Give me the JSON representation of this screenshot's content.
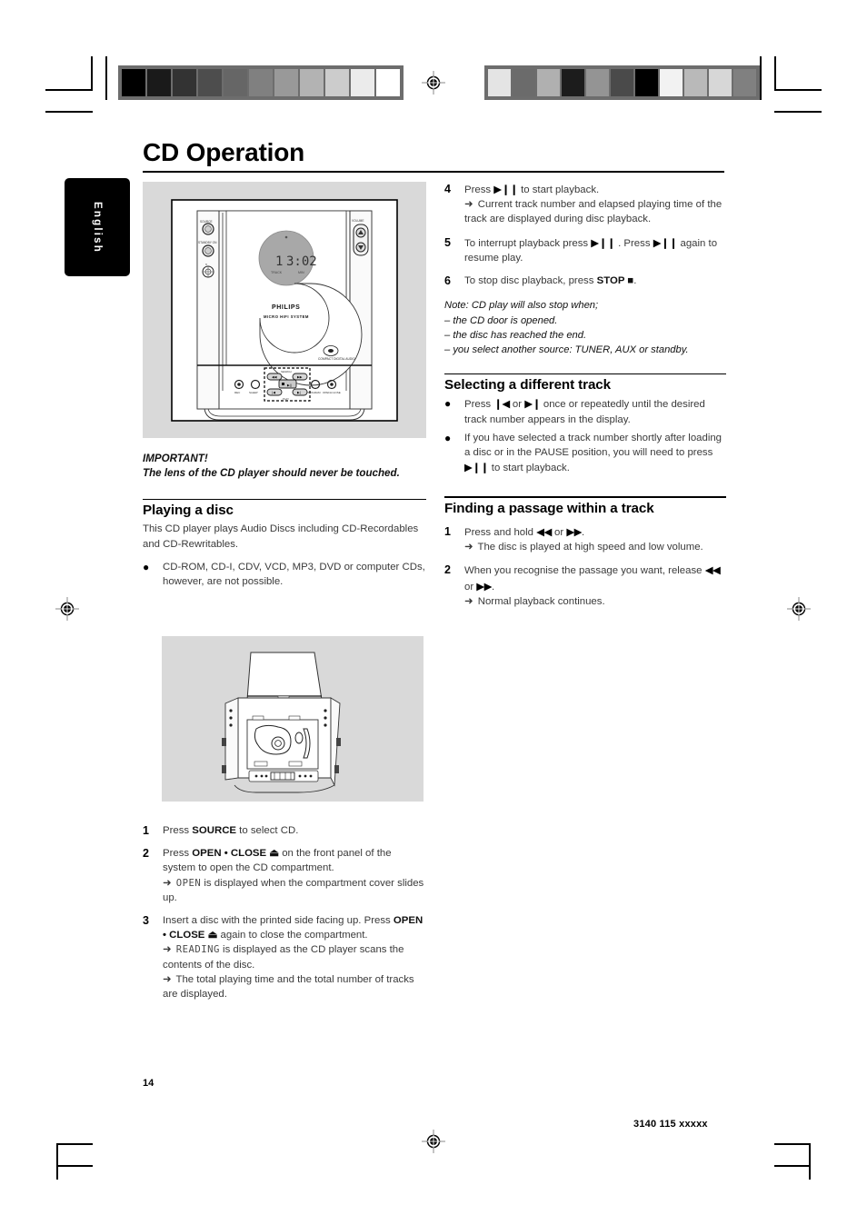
{
  "page": {
    "title": "CD Operation",
    "language_tab": "English",
    "page_number": "14",
    "document_number": "3140 115 xxxxx"
  },
  "device_illustration": {
    "display_track": "1",
    "display_time": "3:02",
    "display_label_track": "TRACK",
    "display_label_min": "MIN",
    "brand": "PHILIPS",
    "brand_sub": "MICRO HIFI SYSTEM",
    "cd_logo": "COMPACT",
    "cd_logo_sub": "DIGITAL AUDIO",
    "left_controls": [
      "SOURCE",
      "STANDBY ON",
      "PHONES"
    ],
    "right_control": "VOLUME",
    "front_buttons": [
      "REC",
      "SLEEP",
      "PROGRAM",
      "OPEN•CLOSE"
    ],
    "transport_labels": [
      "SEARCH",
      "PLAY"
    ]
  },
  "left_column": {
    "important_title": "IMPORTANT!",
    "important_body": "The lens of the CD player should never be touched.",
    "playing_heading": "Playing a disc",
    "playing_intro": "This CD player plays Audio Discs including CD-Recordables and CD-Rewritables.",
    "playing_bullet": "CD-ROM, CD-I, CDV, VCD, MP3, DVD or computer CDs, however, are not possible.",
    "steps": [
      {
        "num": "1",
        "parts": [
          {
            "t": "Press ",
            "s": "n"
          },
          {
            "t": "SOURCE",
            "s": "b"
          },
          {
            "t": " to select CD.",
            "s": "n"
          }
        ]
      },
      {
        "num": "2",
        "parts": [
          {
            "t": "Press ",
            "s": "n"
          },
          {
            "t": "OPEN • CLOSE",
            "s": "b"
          },
          {
            "t": " ⏏",
            "s": "b"
          },
          {
            "t": " on the front panel of the system to open the CD compartment.",
            "s": "n"
          }
        ],
        "results": [
          {
            "pre": "",
            "lcd": "OPEN",
            "post": " is displayed when the compartment cover slides up."
          }
        ]
      },
      {
        "num": "3",
        "parts": [
          {
            "t": "Insert a disc with the printed side facing up. Press ",
            "s": "n"
          },
          {
            "t": "OPEN • CLOSE",
            "s": "b"
          },
          {
            "t": " ⏏",
            "s": "b"
          },
          {
            "t": " again to close the compartment.",
            "s": "n"
          }
        ],
        "results": [
          {
            "pre": "",
            "lcd": "READING",
            "post": " is displayed as the CD player scans the contents of the disc."
          },
          {
            "pre": "The total playing time and the total number of tracks are displayed.",
            "lcd": "",
            "post": ""
          }
        ]
      }
    ]
  },
  "right_column": {
    "steps": [
      {
        "num": "4",
        "parts": [
          {
            "t": "Press ",
            "s": "n"
          },
          {
            "t": "▶❙❙",
            "s": "g"
          },
          {
            "t": " to start playback.",
            "s": "n"
          }
        ],
        "results": [
          {
            "pre": "Current track number and elapsed playing time of the track are displayed during disc playback.",
            "lcd": "",
            "post": ""
          }
        ]
      },
      {
        "num": "5",
        "parts": [
          {
            "t": "To interrupt playback press ",
            "s": "n"
          },
          {
            "t": "▶❙❙",
            "s": "g"
          },
          {
            "t": " . Press ",
            "s": "n"
          },
          {
            "t": "▶❙❙",
            "s": "g"
          },
          {
            "t": " again to resume play.",
            "s": "n"
          }
        ]
      },
      {
        "num": "6",
        "parts": [
          {
            "t": "To stop disc playback, press ",
            "s": "n"
          },
          {
            "t": "STOP",
            "s": "b"
          },
          {
            "t": " ■",
            "s": "b"
          },
          {
            "t": ".",
            "s": "n"
          }
        ]
      }
    ],
    "note_lines": [
      "Note: CD play will also stop when;",
      "– the CD door is opened.",
      "– the disc has reached the end.",
      "– you select another source: TUNER, AUX or standby."
    ],
    "selecting_heading": "Selecting a different track",
    "selecting_bullets": [
      [
        {
          "t": "Press ",
          "s": "n"
        },
        {
          "t": "❙◀",
          "s": "g"
        },
        {
          "t": "  or ",
          "s": "n"
        },
        {
          "t": "▶❙",
          "s": "g"
        },
        {
          "t": "  once or repeatedly until the desired track number appears in the display.",
          "s": "n"
        }
      ],
      [
        {
          "t": "If you have selected a track number shortly after loading a disc or in the PAUSE position, you will need to press ",
          "s": "n"
        },
        {
          "t": "▶❙❙",
          "s": "g"
        },
        {
          "t": " to start playback.",
          "s": "n"
        }
      ]
    ],
    "finding_heading": "Finding a passage within a track",
    "finding_steps": [
      {
        "num": "1",
        "parts": [
          {
            "t": "Press and hold ",
            "s": "n"
          },
          {
            "t": "◀◀",
            "s": "g"
          },
          {
            "t": " or ",
            "s": "n"
          },
          {
            "t": "▶▶",
            "s": "g"
          },
          {
            "t": ".",
            "s": "n"
          }
        ],
        "results": [
          {
            "pre": "The disc is played at high speed and low volume.",
            "lcd": "",
            "post": ""
          }
        ]
      },
      {
        "num": "2",
        "parts": [
          {
            "t": "When you recognise the passage you want, release ",
            "s": "n"
          },
          {
            "t": "◀◀",
            "s": "g"
          },
          {
            "t": " or ",
            "s": "n"
          },
          {
            "t": "▶▶",
            "s": "g"
          },
          {
            "t": ".",
            "s": "n"
          }
        ],
        "results": [
          {
            "pre": "Normal playback continues.",
            "lcd": "",
            "post": ""
          }
        ]
      }
    ]
  },
  "print_marks": {
    "left_bar_swatches": [
      "#000000",
      "#1a1a1a",
      "#333333",
      "#4d4d4d",
      "#666666",
      "#808080",
      "#999999",
      "#b3b3b3",
      "#cccccc",
      "#ebebeb",
      "#ffffff"
    ],
    "right_bar_swatches": [
      "#e4e4e4",
      "#6b6b6b",
      "#b0b0b0",
      "#1c1c1c",
      "#949494",
      "#4a4a4a",
      "#000000",
      "#f2f2f2",
      "#b9b9b9",
      "#d7d7d7",
      "#808080"
    ]
  }
}
